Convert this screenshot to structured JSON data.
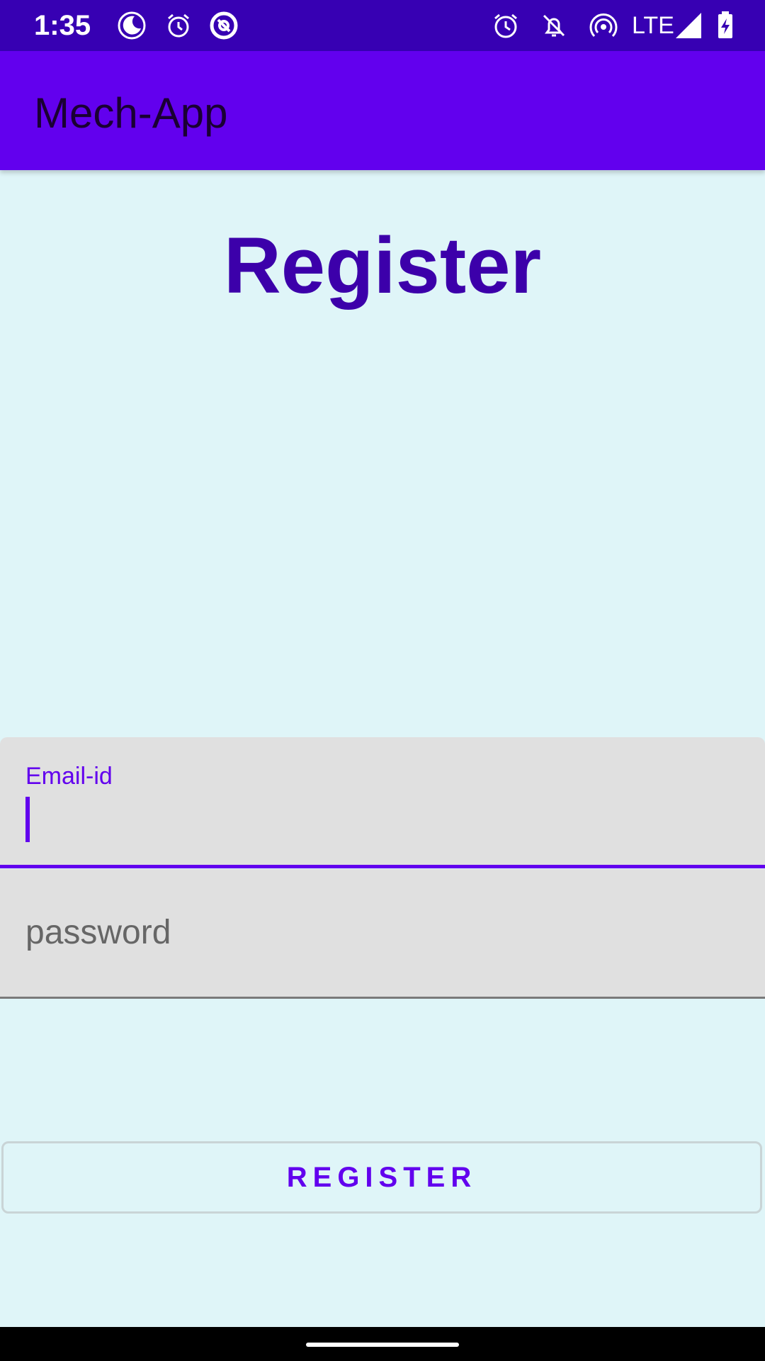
{
  "status_bar": {
    "time": "1:35",
    "network": "LTE",
    "icons": [
      "moon-icon",
      "alarm-icon",
      "data-saver-icon",
      "alarm-icon",
      "notifications-off-icon",
      "hotspot-icon",
      "signal-icon",
      "battery-charging-icon"
    ]
  },
  "app_bar": {
    "title": "Mech-App"
  },
  "main": {
    "heading": "Register",
    "email_field": {
      "label": "Email-id",
      "value": ""
    },
    "password_field": {
      "placeholder": "password",
      "value": ""
    },
    "register_button": {
      "label": "REGISTER"
    }
  },
  "colors": {
    "status_bar": "#3700B3",
    "app_bar": "#6200EE",
    "background": "#DFF5F8",
    "heading": "#3C00AA",
    "accent": "#6200EE",
    "field_bg": "#E0E0E0"
  }
}
